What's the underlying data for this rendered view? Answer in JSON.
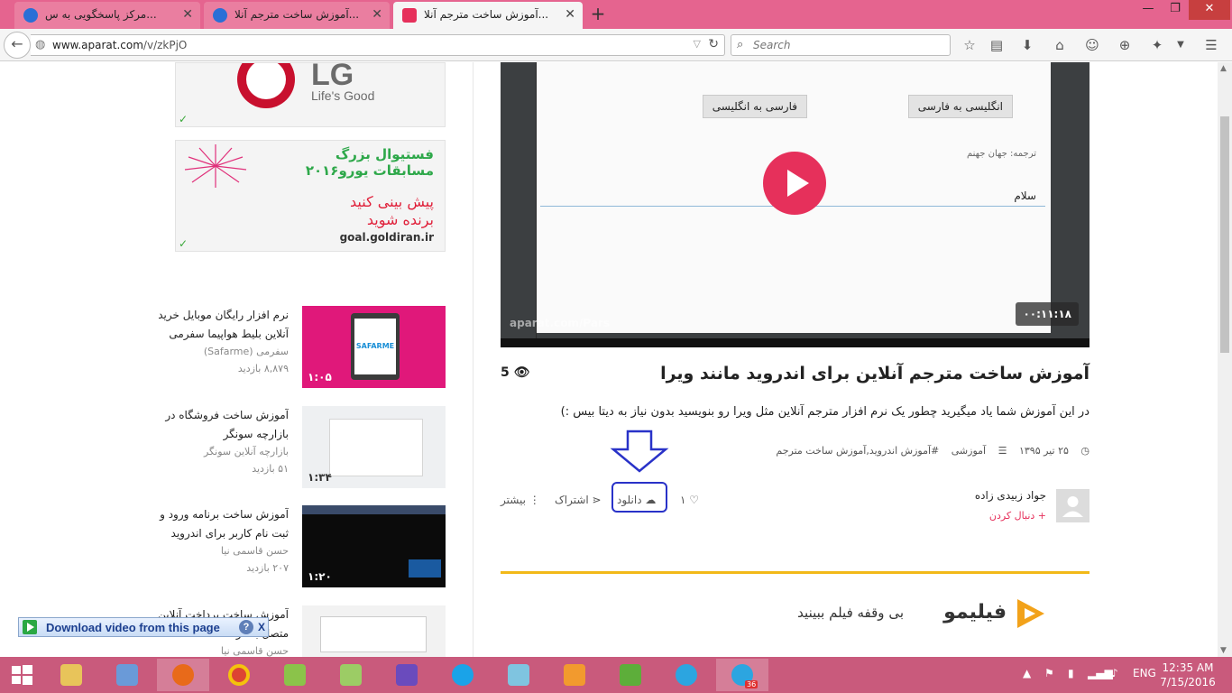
{
  "browser": {
    "tabs": [
      {
        "label": "مرکز پاسخگویی به س...",
        "active": false
      },
      {
        "label": "آموزش ساخت مترجم آنلا...",
        "active": false
      },
      {
        "label": "آموزش ساخت مترجم آنلا...",
        "active": true
      }
    ],
    "new_tab_label": "+",
    "window_controls": {
      "minimize": "—",
      "restore": "❐",
      "close": "✕"
    },
    "url_host": "www.aparat.com",
    "url_path": "/v/zkPjO",
    "search_placeholder": "Search"
  },
  "ads": {
    "lg_brand": "LG",
    "lg_slogan": "Life's Good",
    "euro_line1": "فستیوال بزرگ",
    "euro_line2": "مسابقات یورو۲۰۱۶",
    "euro_line3": "پیش بینی کنید",
    "euro_line4": "برنده شوید",
    "euro_domain": "goal.goldiran.ir"
  },
  "related": [
    {
      "title": "نرم افزار رایگان موبایل خرید آنلاین بلیط هواپیما سفرمی",
      "channel": "سفرمی (Safarme)",
      "views": "۸,۸۷۹ بازدید",
      "duration": "۱:۰۵",
      "thumb_text": "SAFARME"
    },
    {
      "title": "آموزش ساخت فروشگاه در بازارچه سونگر",
      "channel": "بازارچه آنلاین سونگر",
      "views": "۵۱ بازدید",
      "duration": "۱:۳۴"
    },
    {
      "title": "آموزش ساخت برنامه ورود و ثبت نام کاربر برای اندروید",
      "channel": "حسن قاسمی نیا",
      "views": "۲۰۷ بازدید",
      "duration": "۱:۲۰"
    },
    {
      "title": "آموزش ساخت پرداخت آنلاین متصل به درگاه",
      "channel": "حسن قاسمی نیا",
      "views": "",
      "duration": ""
    }
  ],
  "player": {
    "btn_en_fa": "انگلیسی به فارسی",
    "btn_fa_en": "فارسی به انگلیسی",
    "translation_label": "ترجمه: جهان جهنم",
    "input_value": "سلام",
    "duration": "۰۰:۱۱:۱۸",
    "watermark": "aparat.com/Pars"
  },
  "video": {
    "title": "آموزش ساخت مترجم آنلاین برای اندروید مانند ویرا",
    "views": "5",
    "description": "در این آموزش شما یاد میگیرید چطور یک نرم افزار مترجم آنلاین مثل ویرا رو بنویسید بدون نیاز به دیتا بیس :)",
    "date": "۲۵ تیر ۱۳۹۵",
    "category": "آموزشی",
    "tags": "#آموزش اندروید,آموزش ساخت مترجم",
    "author": "جواد زبیدی زاده",
    "follow": "+ دنبال کردن",
    "likes": "۱",
    "download": "دانلود",
    "share": "اشتراک",
    "more": "بیشتر"
  },
  "bottom_ad": {
    "brand": "فیلیمو",
    "tagline": "بی وقفه فیلم ببینید"
  },
  "download_helper": {
    "label": "Download video from this page",
    "help": "?",
    "close": "X"
  },
  "taskbar": {
    "lang": "ENG",
    "time": "12:35 AM",
    "date": "7/15/2016",
    "telegram_badge": "36"
  },
  "colors": {
    "tab_bar": "#e5648f",
    "accent": "#e6305b",
    "taskbar": "#c95a7c",
    "highlight_box": "#2932c8"
  }
}
